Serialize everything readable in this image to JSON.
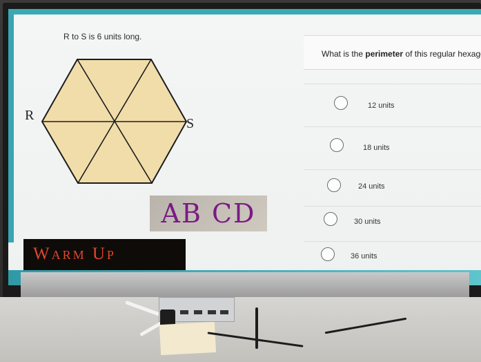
{
  "caption": "R to S is 6 units long.",
  "vertex_labels": {
    "left": "R",
    "right": "S"
  },
  "abcd_logo": "AB CD",
  "banner": "Warm Up",
  "question": {
    "prefix": "What is the ",
    "emphasis": "perimeter",
    "suffix": " of this regular hexagon?"
  },
  "options": [
    {
      "label": "12 units"
    },
    {
      "label": "18 units"
    },
    {
      "label": "24 units"
    },
    {
      "label": "30 units"
    },
    {
      "label": "36 units"
    }
  ],
  "colors": {
    "accent": "#3aa9b4",
    "hexagon_fill": "#f1ddaa",
    "banner_text": "#e0482e",
    "logo_text": "#7a1a85"
  },
  "icons": {
    "radio": "radio-circle-icon"
  }
}
